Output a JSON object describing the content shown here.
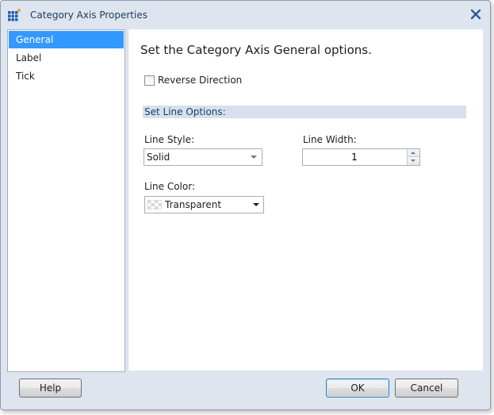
{
  "window": {
    "title": "Category Axis Properties"
  },
  "icons": {
    "app": "chart-grid-icon",
    "close": "close-icon",
    "swatch": "transparent-swatch-icon"
  },
  "sidebar": {
    "items": [
      {
        "label": "General",
        "selected": true
      },
      {
        "label": "Label",
        "selected": false
      },
      {
        "label": "Tick",
        "selected": false
      }
    ]
  },
  "main": {
    "title": "Set the Category Axis General options.",
    "reverse_direction": {
      "label": "Reverse Direction",
      "checked": false
    },
    "line_options_header": "Set Line Options:",
    "line_style": {
      "label": "Line Style:",
      "value": "Solid"
    },
    "line_width": {
      "label": "Line Width:",
      "value": "1"
    },
    "line_color": {
      "label": "Line Color:",
      "value": "Transparent"
    }
  },
  "buttons": {
    "help": "Help",
    "ok": "OK",
    "cancel": "Cancel"
  },
  "colors": {
    "selection": "#3399ff",
    "section_header": "#d6e0ef",
    "frame": "#dfe5ee"
  }
}
